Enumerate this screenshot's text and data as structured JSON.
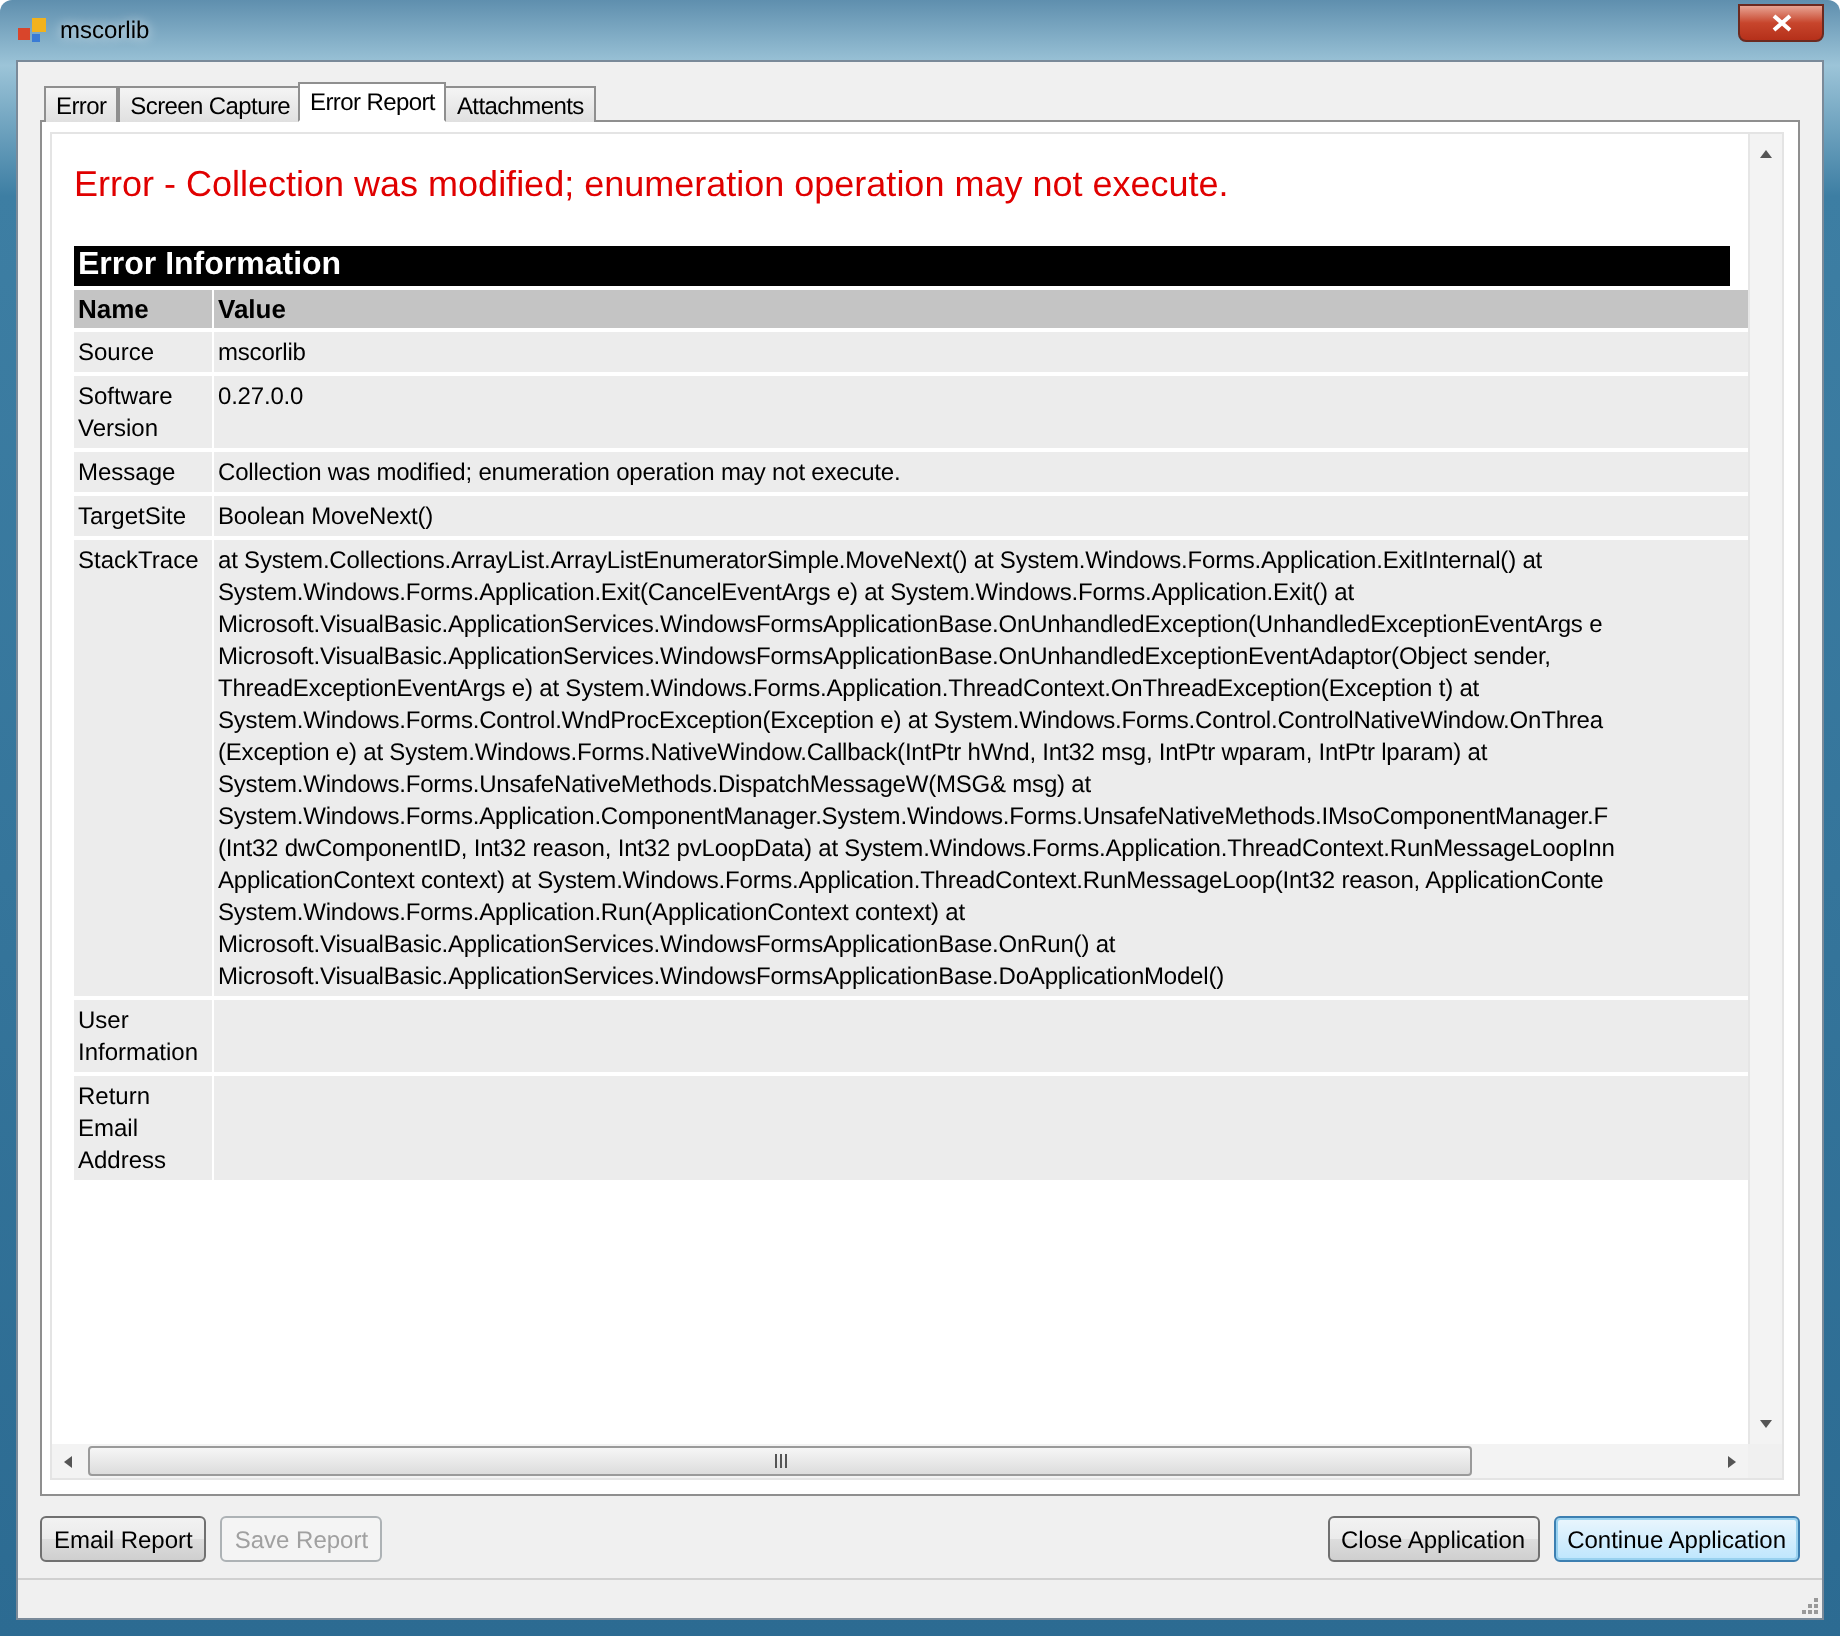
{
  "window": {
    "title": "mscorlib"
  },
  "tabs": [
    {
      "label": "Error",
      "selected": false
    },
    {
      "label": "Screen Capture",
      "selected": false
    },
    {
      "label": "Error Report",
      "selected": true
    },
    {
      "label": "Attachments",
      "selected": false
    }
  ],
  "report": {
    "heading": "Error - Collection was modified; enumeration operation may not execute.",
    "section_title": "Error Information",
    "columns": [
      "Name",
      "Value"
    ],
    "rows": [
      {
        "name": "Source",
        "lines": [
          "mscorlib"
        ]
      },
      {
        "name": "Software Version",
        "lines": [
          "0.27.0.0"
        ]
      },
      {
        "name": "Message",
        "lines": [
          "Collection was modified; enumeration operation may not execute."
        ]
      },
      {
        "name": "TargetSite",
        "lines": [
          "Boolean MoveNext()"
        ]
      },
      {
        "name": "StackTrace",
        "lines": [
          "at System.Collections.ArrayList.ArrayListEnumeratorSimple.MoveNext() at System.Windows.Forms.Application.ExitInternal() at",
          "System.Windows.Forms.Application.Exit(CancelEventArgs e) at System.Windows.Forms.Application.Exit() at",
          "Microsoft.VisualBasic.ApplicationServices.WindowsFormsApplicationBase.OnUnhandledException(UnhandledExceptionEventArgs e",
          "Microsoft.VisualBasic.ApplicationServices.WindowsFormsApplicationBase.OnUnhandledExceptionEventAdaptor(Object sender,",
          "ThreadExceptionEventArgs e) at System.Windows.Forms.Application.ThreadContext.OnThreadException(Exception t) at",
          "System.Windows.Forms.Control.WndProcException(Exception e) at System.Windows.Forms.Control.ControlNativeWindow.OnThrea",
          "(Exception e) at System.Windows.Forms.NativeWindow.Callback(IntPtr hWnd, Int32 msg, IntPtr wparam, IntPtr lparam) at",
          "System.Windows.Forms.UnsafeNativeMethods.DispatchMessageW(MSG& msg) at",
          "System.Windows.Forms.Application.ComponentManager.System.Windows.Forms.UnsafeNativeMethods.IMsoComponentManager.F",
          "(Int32 dwComponentID, Int32 reason, Int32 pvLoopData) at System.Windows.Forms.Application.ThreadContext.RunMessageLoopInn",
          "ApplicationContext context) at System.Windows.Forms.Application.ThreadContext.RunMessageLoop(Int32 reason, ApplicationConte",
          "System.Windows.Forms.Application.Run(ApplicationContext context) at",
          "Microsoft.VisualBasic.ApplicationServices.WindowsFormsApplicationBase.OnRun() at",
          "Microsoft.VisualBasic.ApplicationServices.WindowsFormsApplicationBase.DoApplicationModel()"
        ]
      },
      {
        "name": "User Information",
        "lines": []
      },
      {
        "name": "Return Email Address",
        "lines": []
      }
    ]
  },
  "buttons_left": [
    {
      "label": "Email Report",
      "disabled": false
    },
    {
      "label": "Save Report",
      "disabled": true
    }
  ],
  "buttons_right": [
    {
      "label": "Close Application",
      "default": false
    },
    {
      "label": "Continue Application",
      "default": true
    }
  ]
}
